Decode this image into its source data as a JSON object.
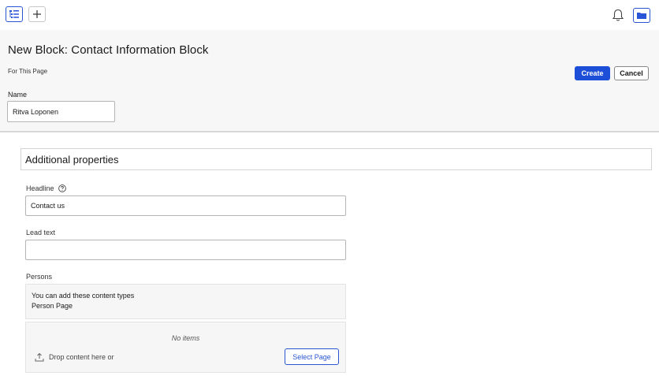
{
  "topbar": {
    "tree_icon": "tree-list-icon",
    "add_icon": "plus-icon",
    "bell_icon": "bell-icon",
    "folder_icon": "folder-icon",
    "accent": "#2a55d6"
  },
  "header": {
    "title": "New Block: Contact Information Block",
    "for_page": "For This Page",
    "create_label": "Create",
    "cancel_label": "Cancel",
    "name_label": "Name",
    "name_value": "Ritva Loponen"
  },
  "main": {
    "section_title": "Additional properties",
    "headline": {
      "label": "Headline",
      "value": "Contact us"
    },
    "lead_text": {
      "label": "Lead text",
      "value": ""
    },
    "persons": {
      "label": "Persons",
      "types_intro": "You can add these content types",
      "types_list": "Person Page",
      "no_items": "No items",
      "drop_text": "Drop content here or",
      "select_label": "Select Page"
    }
  },
  "colors": {
    "primary_button": "#1d4ed8",
    "header_bg": "#f7f7f7"
  }
}
